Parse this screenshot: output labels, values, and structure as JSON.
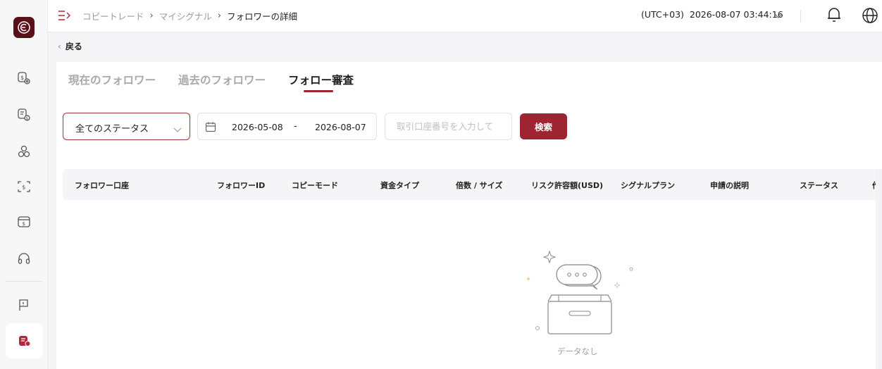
{
  "breadcrumb": {
    "items": [
      "コピートレード",
      "マイシグナル",
      "フォロワーの詳細"
    ]
  },
  "header": {
    "timezone": "(UTC+03)",
    "datetime": "2026-08-07 03:44:16"
  },
  "back_label": "戻る",
  "tabs": [
    {
      "label": "現在のフォロワー",
      "active": false
    },
    {
      "label": "過去のフォロワー",
      "active": false
    },
    {
      "label": "フォロー審査",
      "active": true
    }
  ],
  "filters": {
    "status_value": "全てのステータス",
    "date_from": "2026-05-08",
    "date_separator": "-",
    "date_to": "2026-08-07",
    "account_placeholder": "取引口座番号を入力して",
    "search_label": "検索"
  },
  "table": {
    "columns": [
      "フォロワー口座",
      "フォロワーID",
      "コピーモード",
      "資金タイプ",
      "倍数 / サイズ",
      "リスク許容額(USD)",
      "シグナルプラン",
      "申請の説明",
      "ステータス",
      "作"
    ],
    "rows": []
  },
  "empty_label": "データなし",
  "icons": {
    "logo": "brand-logo-icon",
    "sidebar": [
      "dollar-settings-icon",
      "dollar-swap-icon",
      "user-group-icon",
      "scan-dollar-icon",
      "wallet-dollar-icon",
      "headset-icon",
      "flag-icon",
      "copy-trade-icon"
    ]
  },
  "colors": {
    "accent": "#9e2432",
    "brand": "#5a1018"
  }
}
